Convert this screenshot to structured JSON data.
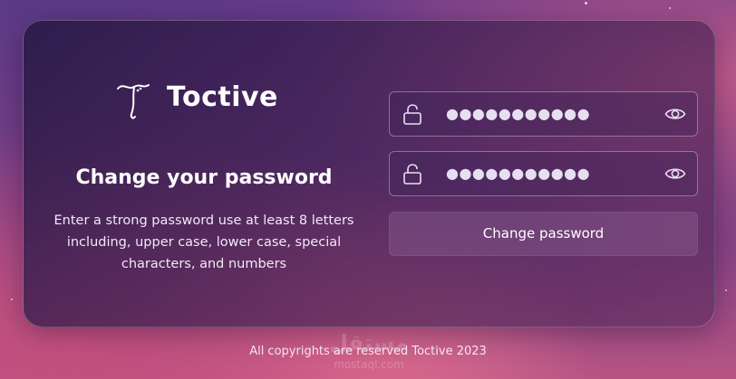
{
  "brand": {
    "name": "Toctive"
  },
  "heading": {
    "title": "Change your password"
  },
  "description": {
    "text": "Enter a strong password use at least 8 letters including, upper case, lower case, special characters, and numbers"
  },
  "form": {
    "new_password": {
      "masked_value": "●●●●●●●●●●●",
      "lock_icon": "lock-open-icon",
      "toggle_icon": "eye-icon"
    },
    "confirm_password": {
      "masked_value": "●●●●●●●●●●●",
      "lock_icon": "lock-open-icon",
      "toggle_icon": "eye-icon"
    },
    "submit_label": "Change password"
  },
  "footer": {
    "text": "All copyrights are reserved Toctive 2023"
  },
  "watermark": {
    "text": "مستقل",
    "sub": "mostaql.com"
  },
  "colors": {
    "accent": "#ffffff",
    "card": "#2e1b4a",
    "background": "#6b3c8a"
  }
}
